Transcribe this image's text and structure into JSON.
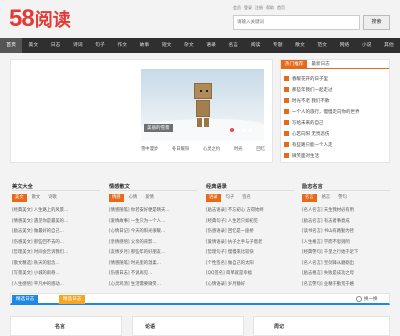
{
  "logo": {
    "num": "58",
    "text": "阅读"
  },
  "toplinks": [
    "会员",
    "登录",
    "注册",
    "帮助",
    "首页"
  ],
  "search": {
    "placeholder": "请输入关键词",
    "button": "搜索"
  },
  "nav": [
    "首页",
    "美文",
    "日志",
    "诗词",
    "句子",
    "作文",
    "故事",
    "短文",
    "杂文",
    "语录",
    "名言",
    "阅读",
    "专题",
    "散文",
    "范文",
    "网络",
    "小说",
    "其他"
  ],
  "hero": {
    "caption": "美丽的雪景",
    "thumbs": [
      "雪中漫步",
      "冬日暖阳",
      "心灵之约",
      "时光",
      "回忆"
    ]
  },
  "side": {
    "tabs": [
      "热门推荐",
      "最新日志"
    ],
    "items": [
      "春暖花开的日子里",
      "那些年我们一起走过",
      "时光不老 我们不散",
      "一个人的旅行，慢慢走向你的世界",
      "写给未来的自己",
      "心若向阳 无畏悲伤",
      "有些路只能一个人走",
      "微笑面对生活"
    ]
  },
  "columns": [
    {
      "title": "美文大全",
      "tabs": [
        "美文",
        "散文",
        "诗歌"
      ],
      "items": [
        "[经典美文] 人生路上的风景…",
        "[情感美文] 遇见你是最美的…",
        "[励志美文] 做最好的自己…",
        "[伤感美文] 那些回不去的…",
        "[哲理美文] 时间会告诉我们…",
        "[散文精选] 秋天的思念…",
        "[写景美文] 小城的雨巷…",
        "[人生感悟] 平凡中的感动…"
      ]
    },
    {
      "title": "情感散文",
      "tabs": [
        "情感",
        "心情",
        "爱情"
      ],
      "items": [
        "[情感随笔] 你若安好便是晴天…",
        "[爱情故事] 一生只为一个人…",
        "[心情日记] 今天的阳光很暖…",
        "[亲情感悟] 父亲的背影…",
        "[友情岁月] 那些年的好朋友…",
        "[情感随笔] 时光里的温柔…",
        "[伤感日志] 不说再见…",
        "[心灵鸡汤] 生活需要微笑…"
      ]
    },
    {
      "title": "经典语录",
      "tabs": [
        "语录",
        "句子",
        "签名"
      ],
      "items": [
        "[励志语录] 不忘初心 方得始终",
        "[经典句子] 人生若只如初见",
        "[伤感语录] 回忆是一座桥",
        "[爱情语录] 执子之手与子偕老",
        "[哲理句子] 慢慢来比较快",
        "[个性签名] 做自己的太阳",
        "[QQ签名] 简单就是幸福",
        "[心情语录] 岁月静好"
      ]
    },
    {
      "title": "励志名言",
      "tabs": [
        "名言",
        "格言",
        "警句"
      ],
      "items": [
        "[名人名言] 天生我材必有用",
        "[励志名言] 有志者事竟成",
        "[读书名言] 书山有路勤为径",
        "[人生格言] 学而不思则罔",
        "[经典警句] 千里之行始于足下",
        "[名人名言] 宝剑锋从磨砺出",
        "[励志格言] 失败是成功之母",
        "[名言警句] 业精于勤荒于嬉"
      ]
    }
  ],
  "bottom": {
    "tabs": [
      "精选日志",
      "精品日志"
    ],
    "refresh": "换一换",
    "cards": [
      "名言",
      "论语",
      "周记"
    ]
  }
}
